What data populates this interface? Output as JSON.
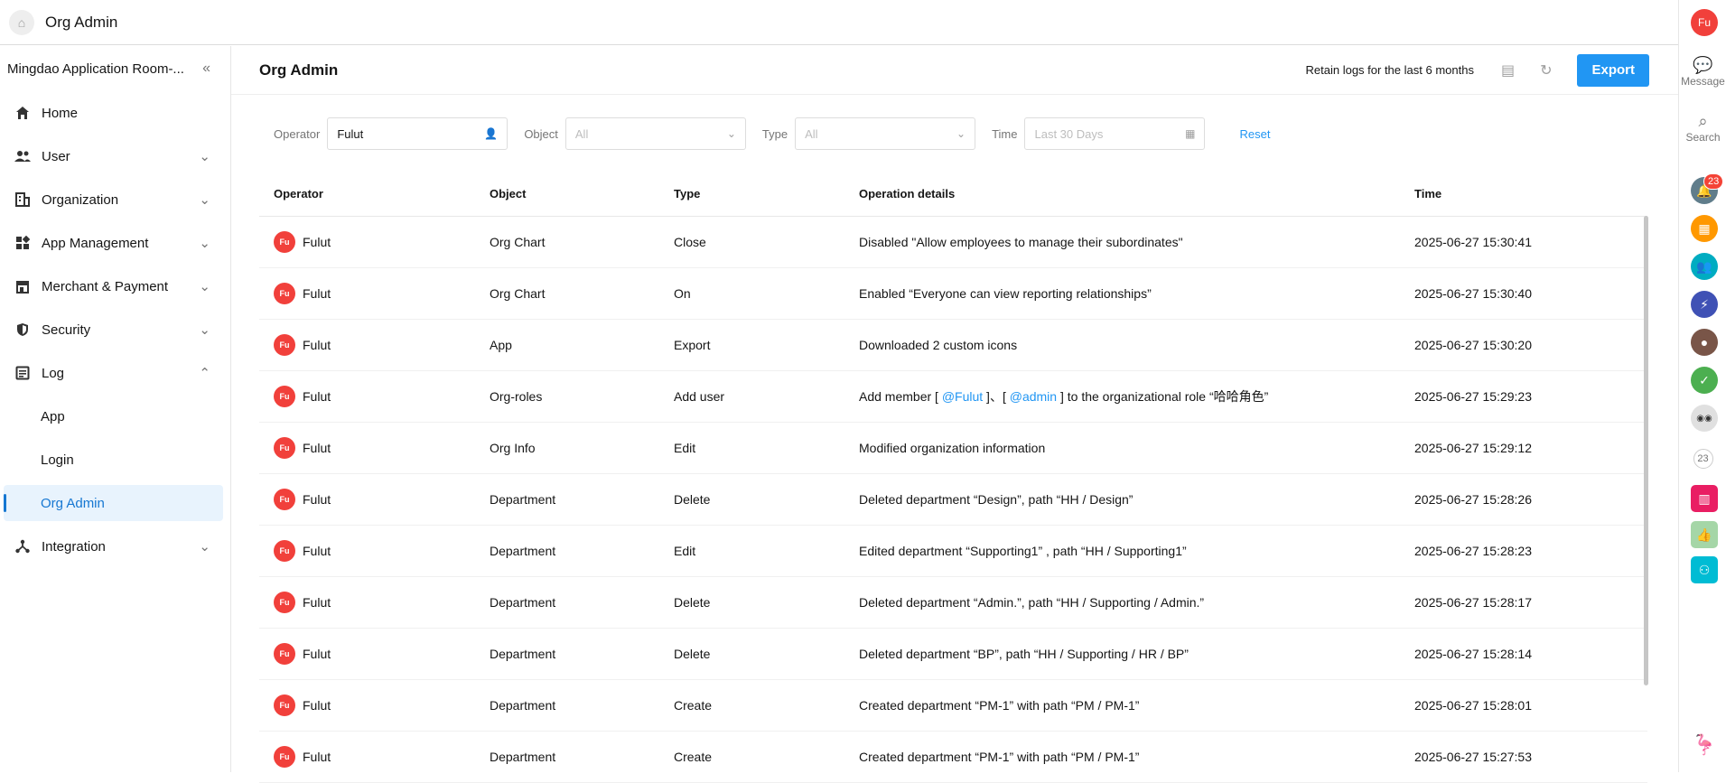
{
  "topbar": {
    "title": "Org Admin",
    "user_initials": "Fu"
  },
  "sidebar": {
    "org_name": "Mingdao Application Room-...",
    "items": [
      {
        "label": "Home",
        "icon": "home-icon",
        "chev": ""
      },
      {
        "label": "User",
        "icon": "users-icon",
        "chev": "⌄"
      },
      {
        "label": "Organization",
        "icon": "building-icon",
        "chev": "⌄"
      },
      {
        "label": "App Management",
        "icon": "apps-icon",
        "chev": "⌄"
      },
      {
        "label": "Merchant & Payment",
        "icon": "store-icon",
        "chev": "⌄"
      },
      {
        "label": "Security",
        "icon": "shield-icon",
        "chev": "⌄"
      },
      {
        "label": "Log",
        "icon": "log-icon",
        "chev": "⌃"
      }
    ],
    "log_sub": [
      "App",
      "Login",
      "Org Admin"
    ],
    "integration": {
      "label": "Integration",
      "icon": "integration-icon"
    }
  },
  "header": {
    "title": "Org Admin",
    "retain": "Retain logs for the last 6 months",
    "export": "Export"
  },
  "filters": {
    "operator_label": "Operator",
    "operator_value": "Fulut",
    "object_label": "Object",
    "object_value": "All",
    "type_label": "Type",
    "type_value": "All",
    "time_label": "Time",
    "time_value": "Last 30 Days",
    "reset": "Reset"
  },
  "table": {
    "columns": [
      "Operator",
      "Object",
      "Type",
      "Operation details",
      "Time"
    ],
    "rows": [
      {
        "op": "Fulut",
        "obj": "Org Chart",
        "type": "Close",
        "details": "Disabled \"Allow employees to manage their subordinates\"",
        "time": "2025-06-27 15:30:41"
      },
      {
        "op": "Fulut",
        "obj": "Org Chart",
        "type": "On",
        "details": "Enabled “Everyone can view reporting relationships”",
        "time": "2025-06-27 15:30:40"
      },
      {
        "op": "Fulut",
        "obj": "App",
        "type": "Export",
        "details": "Downloaded 2 custom icons",
        "time": "2025-06-27 15:30:20"
      },
      {
        "op": "Fulut",
        "obj": "Org-roles",
        "type": "Add user",
        "details_pre": "Add member [ ",
        "m1": "@Fulut",
        "details_mid": " ]、[ ",
        "m2": "@admin",
        "details_post": " ] to the organizational role “哈哈角色”",
        "time": "2025-06-27 15:29:23"
      },
      {
        "op": "Fulut",
        "obj": "Org Info",
        "type": "Edit",
        "details": "Modified organization information",
        "time": "2025-06-27 15:29:12"
      },
      {
        "op": "Fulut",
        "obj": "Department",
        "type": "Delete",
        "details": "Deleted department “Design”, path “HH / Design”",
        "time": "2025-06-27 15:28:26"
      },
      {
        "op": "Fulut",
        "obj": "Department",
        "type": "Edit",
        "details": "Edited department “Supporting1” , path “HH / Supporting1”",
        "time": "2025-06-27 15:28:23"
      },
      {
        "op": "Fulut",
        "obj": "Department",
        "type": "Delete",
        "details": "Deleted department “Admin.”, path “HH / Supporting / Admin.”",
        "time": "2025-06-27 15:28:17"
      },
      {
        "op": "Fulut",
        "obj": "Department",
        "type": "Delete",
        "details": "Deleted department “BP”, path “HH / Supporting / HR / BP”",
        "time": "2025-06-27 15:28:14"
      },
      {
        "op": "Fulut",
        "obj": "Department",
        "type": "Create",
        "details": "Created department “PM-1” with path “PM / PM-1”",
        "time": "2025-06-27 15:28:01"
      },
      {
        "op": "Fulut",
        "obj": "Department",
        "type": "Create",
        "details": "Created department “PM-1” with path “PM / PM-1”",
        "time": "2025-06-27 15:27:53"
      }
    ]
  },
  "rail": {
    "message": "Message",
    "search": "Search",
    "badge": "23",
    "count": "23"
  },
  "colors": {
    "accent": "#2196f3",
    "avatar": "#f1403b"
  }
}
